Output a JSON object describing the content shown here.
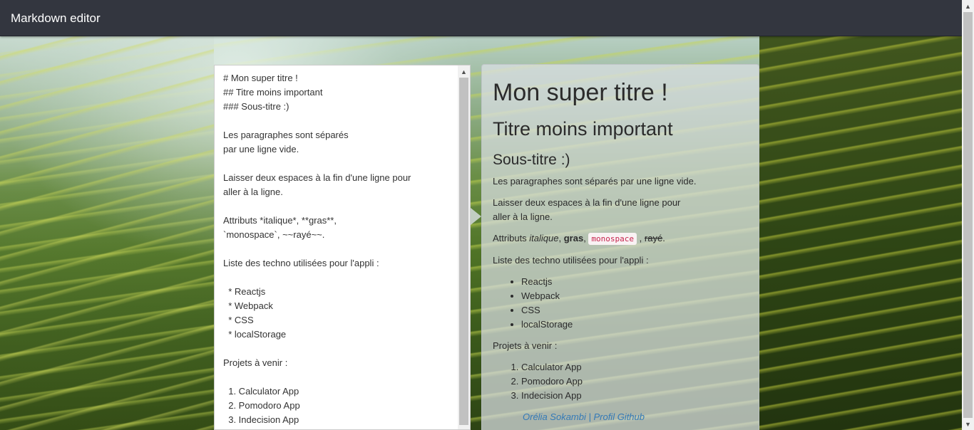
{
  "navbar": {
    "title": "Markdown editor"
  },
  "editor": {
    "content": "# Mon super titre !\n## Titre moins important\n### Sous-titre :)\n\nLes paragraphes sont séparés\npar une ligne vide.\n\nLaisser deux espaces à la fin d'une ligne pour\naller à la ligne.\n\nAttributs *italique*, **gras**,\n`monospace`, ~~rayé~~.\n\nListe des techno utilisées pour l'appli :\n\n  * Reactjs\n  * Webpack\n  * CSS\n  * localStorage\n\nProjets à venir :\n\n  1. Calculator App\n  2. Pomodoro App\n  3. Indecision App"
  },
  "preview": {
    "h1": "Mon super titre !",
    "h2": "Titre moins important",
    "h3": "Sous-titre :)",
    "p1": "Les paragraphes sont séparés par une ligne vide.",
    "p2_line1": "Laisser deux espaces à la fin d'une ligne pour",
    "p2_line2": "aller à la ligne.",
    "attrs": {
      "prefix": "Attributs ",
      "italic": "italique",
      "sep1": ", ",
      "bold": "gras",
      "sep2": ", ",
      "mono": "monospace",
      "sep3": " , ",
      "strike": "rayé",
      "suffix": "."
    },
    "techno_intro": "Liste des techno utilisées pour l'appli :",
    "techno_list": [
      "Reactjs",
      "Webpack",
      "CSS",
      "localStorage"
    ],
    "projects_intro": "Projets à venir :",
    "projects_list": [
      "Calculator App",
      "Pomodoro App",
      "Indecision App"
    ],
    "footer_link": "Orélia Sokambi | Profil Github"
  },
  "icons": {
    "scroll_up": "chevron-up-icon",
    "scroll_down": "chevron-down-icon"
  }
}
